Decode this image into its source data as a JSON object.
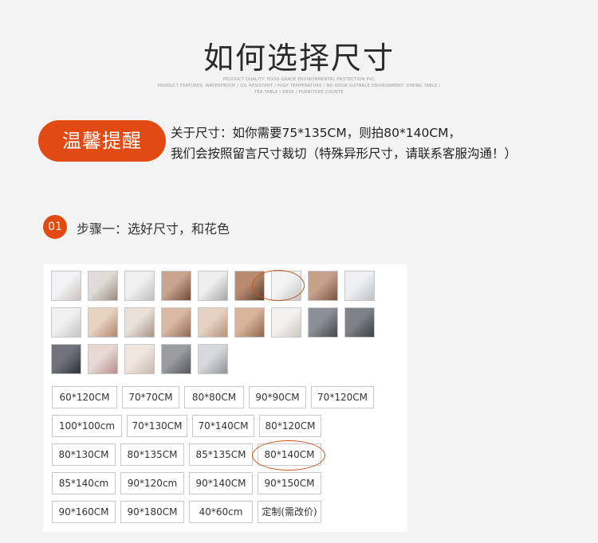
{
  "header": {
    "title": "如何选择尺寸",
    "sub_lines": [
      "PRODUCT QUALITY: FOOD GRADE ENVIRONMENTAL PROTECTION PVC",
      "PRODUCT FEATURES: WATERPROOF / OIL RESISTANT / HIGH TEMPERATURE / NO ODOR SUITABLE ENVIRONMENT: DINING TABLE /",
      "TEA TABLE / DESK / FURNITURE COUNTE"
    ]
  },
  "tip": {
    "badge": "温馨提醒",
    "line1": "关于尺寸：如你需要75*135CM，则拍80*140CM，",
    "line2": "我们会按照留言尺寸裁切（特殊异形尺寸，请联系客服沟通！）"
  },
  "step": {
    "number": "01",
    "label": "步骤一：选好尺寸，和花色"
  },
  "thumb_colors": [
    [
      "#f2f3f5",
      "#c9c2bd"
    ],
    [
      "#e0dcd8",
      "#9a8a7e"
    ],
    [
      "#f0f0f0",
      "#bfbfbf"
    ],
    [
      "#c9a58f",
      "#6e4b3a"
    ],
    [
      "#eeeeee",
      "#a7a7a7"
    ],
    [
      "#b88a70",
      "#5a3b2b"
    ],
    [
      "#f3f3f3",
      "#c5c5c5"
    ],
    [
      "#c7a08a",
      "#7b5543"
    ],
    [
      "#eef0f2",
      "#bcc2c8"
    ],
    [
      "#f1f1f1",
      "#c3c3c3"
    ],
    [
      "#e8d2c0",
      "#b08670"
    ],
    [
      "#e9e1da",
      "#a99384"
    ],
    [
      "#d9b9a3",
      "#8d6a56"
    ],
    [
      "#e6d2c3",
      "#b4917c"
    ],
    [
      "#d8b49a",
      "#8e6651"
    ],
    [
      "#f4f2f0",
      "#cdc6c0"
    ],
    [
      "#8c8f96",
      "#44474d"
    ],
    [
      "#7e8289",
      "#3c3f45"
    ],
    [
      "#6f737b",
      "#2f3238"
    ],
    [
      "#e8d9d5",
      "#b58f8b"
    ],
    [
      "#efe6df",
      "#c9b7aa"
    ],
    [
      "#9a9ca0",
      "#55575b"
    ],
    [
      "#d7d9dc",
      "#8f9398"
    ]
  ],
  "sizes": [
    [
      "60*120CM",
      "70*70CM",
      "80*80CM",
      "90*90CM",
      "70*120CM"
    ],
    [
      "100*100cm",
      "70*130CM",
      "70*140CM",
      "80*120CM"
    ],
    [
      "80*130CM",
      "80*135CM",
      "85*135CM",
      "80*140CM"
    ],
    [
      "85*140cm",
      "90*120cm",
      "90*140CM",
      "90*150CM"
    ],
    [
      "90*160CM",
      "90*180CM",
      "40*60cm",
      "定制(需改价)"
    ]
  ],
  "colors": {
    "accent": "#e14a12",
    "circle": "#c2541d"
  }
}
